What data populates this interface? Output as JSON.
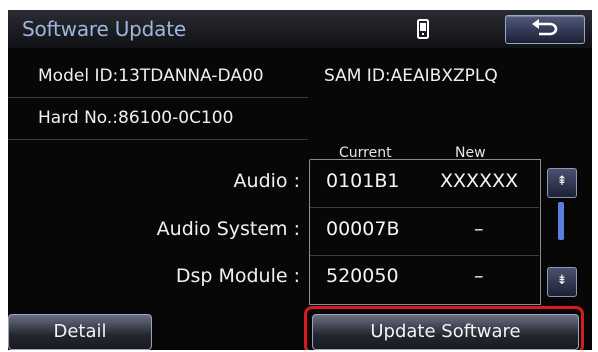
{
  "header": {
    "title": "Software Update",
    "phone_icon": "phone-signal-icon",
    "back_icon": "back-arrow-icon"
  },
  "info": {
    "model_id": "Model ID:13TDANNA-DA00",
    "sam_id": "SAM ID:AEAIBXZPLQ",
    "hard_no": "Hard No.:86100-0C100"
  },
  "table": {
    "columns": {
      "current": "Current",
      "new": "New"
    },
    "rows": [
      {
        "label": "Audio :",
        "current": "0101B1",
        "new": "XXXXXX"
      },
      {
        "label": "Audio System :",
        "current": "00007B",
        "new": "–"
      },
      {
        "label": "Dsp Module :",
        "current": "520050",
        "new": "–"
      }
    ]
  },
  "scroll": {
    "up_icon": "scroll-up-icon",
    "up_glyph": "⇞",
    "down_icon": "scroll-down-icon",
    "down_glyph": "⇟"
  },
  "buttons": {
    "detail": "Detail",
    "update": "Update Software"
  },
  "colors": {
    "title": "#9fb6df",
    "highlight": "#d81a1a",
    "scroll_thumb": "#5b7fe0"
  }
}
